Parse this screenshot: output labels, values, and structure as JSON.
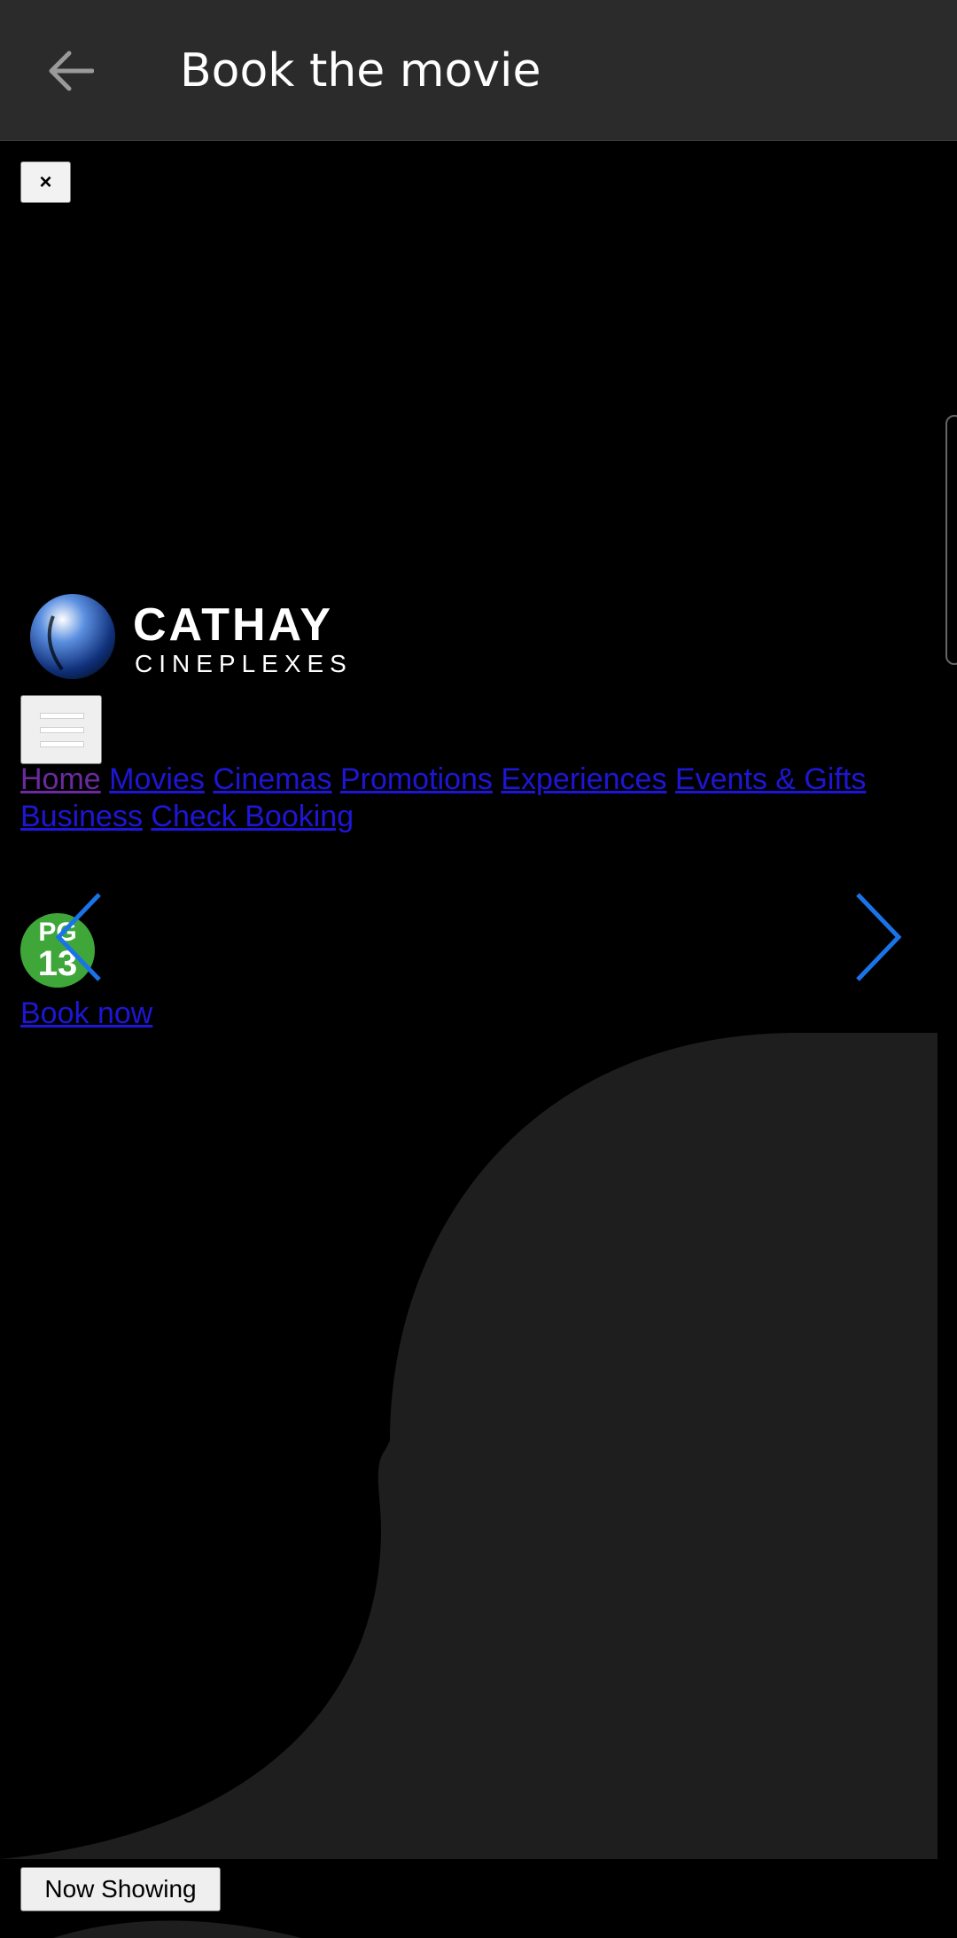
{
  "appbar": {
    "back_icon": "arrow-left-icon",
    "title": "Book the movie"
  },
  "close_button": {
    "label": "×"
  },
  "logo": {
    "brand": "CATHAY",
    "sub": "CINEPLEXES"
  },
  "menu_button": {
    "icon": "hamburger-icon"
  },
  "nav": {
    "items": [
      {
        "label": "Home",
        "visited": true
      },
      {
        "label": "Movies"
      },
      {
        "label": "Cinemas"
      },
      {
        "label": "Promotions"
      },
      {
        "label": "Experiences"
      },
      {
        "label": "Events & Gifts"
      },
      {
        "label": "Business"
      },
      {
        "label": "Check Booking"
      }
    ]
  },
  "rating_badge": {
    "top": "PG",
    "bottom": "13"
  },
  "carousel": {
    "prev_icon": "chevron-left-icon",
    "next_icon": "chevron-right-icon"
  },
  "book_now": "Book now",
  "now_showing": "Now Showing",
  "colors": {
    "appbar": "#2b2b2b",
    "link": "#1e16d6",
    "visited_link": "#6b2aa0",
    "arrow": "#1a73e8",
    "badge": "#3fa63a",
    "hero_shape": "#1e1e1e"
  }
}
